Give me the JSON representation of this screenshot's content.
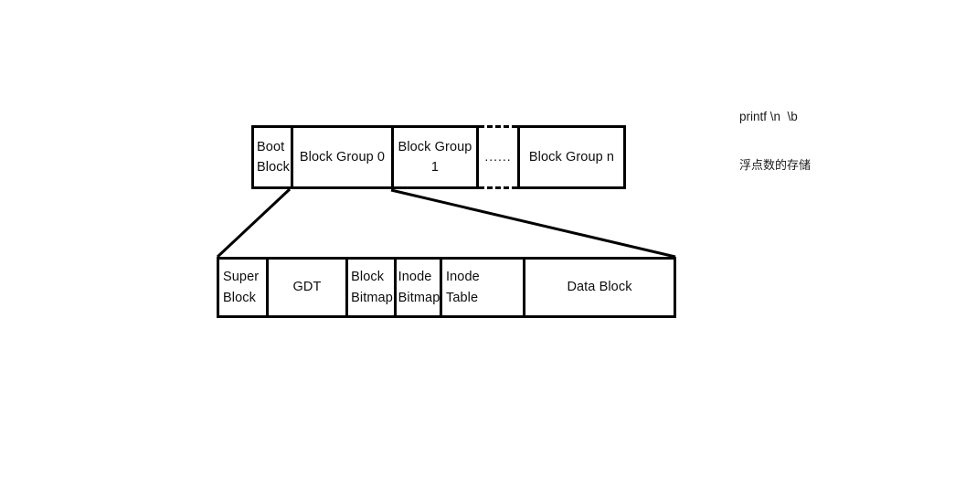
{
  "diagram": {
    "title": "ext2 filesystem layout diagram",
    "colors": {
      "stroke": "#000000",
      "text": "#0d0d0d",
      "background": "#ffffff"
    },
    "disk_row": {
      "name": "disk-partition-row",
      "cells": [
        {
          "id": "boot-block",
          "label": "Boot\nBlock",
          "align": "left"
        },
        {
          "id": "block-group-0",
          "label": "Block Group 0",
          "align": "center"
        },
        {
          "id": "block-group-1",
          "label": "Block Group 1",
          "align": "center"
        },
        {
          "id": "ellipsis",
          "label": "......",
          "align": "center"
        },
        {
          "id": "block-group-n",
          "label": "Block Group n",
          "align": "center"
        }
      ]
    },
    "block_group_row": {
      "name": "block-group-detail-row",
      "cells": [
        {
          "id": "super-block",
          "label": "Super\nBlock",
          "align": "left"
        },
        {
          "id": "gdt",
          "label": "GDT",
          "align": "center"
        },
        {
          "id": "block-bitmap",
          "label": "Block\nBitmap",
          "align": "left"
        },
        {
          "id": "inode-bitmap",
          "label": "Inode\nBitmap",
          "align": "left"
        },
        {
          "id": "inode-table",
          "label": "Inode\nTable",
          "align": "left"
        },
        {
          "id": "data-block",
          "label": "Data Block",
          "align": "center"
        }
      ]
    }
  },
  "notes": [
    {
      "id": "printf-note",
      "text": "printf \\n  \\b"
    },
    {
      "id": "float-note",
      "text": "浮点数的存储"
    }
  ]
}
